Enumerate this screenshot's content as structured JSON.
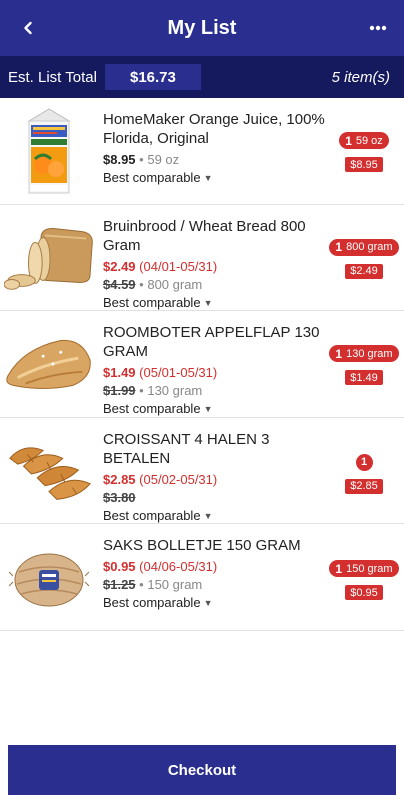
{
  "header": {
    "title": "My List",
    "back_icon": "chevron-left-icon",
    "more_icon": "more-horizontal-icon"
  },
  "totalbar": {
    "label": "Est. List Total",
    "amount": "$16.73",
    "count": "5 item(s)"
  },
  "items": [
    {
      "name": "HomeMaker Orange Juice, 100% Florida, Original",
      "price": "$8.95",
      "size": "59 oz",
      "compare": "Best comparable",
      "qty": "1",
      "qty_unit": "59 oz",
      "tag": "$8.95",
      "image": "orange-juice-carton-image"
    },
    {
      "name": "Bruinbrood / Wheat Bread 800 Gram",
      "price": "$2.49",
      "dates": "(04/01-05/31)",
      "old_price": "$4.59",
      "size": "800 gram",
      "compare": "Best comparable",
      "qty": "1",
      "qty_unit": "800 gram",
      "tag": "$2.49",
      "image": "wheat-bread-loaf-image"
    },
    {
      "name": "ROOMBOTER APPELFLAP 130 GRAM",
      "price": "$1.49",
      "dates": "(05/01-05/31)",
      "old_price": "$1.99",
      "size": "130 gram",
      "compare": "Best comparable",
      "qty": "1",
      "qty_unit": "130 gram",
      "tag": "$1.49",
      "image": "apple-turnover-pastry-image"
    },
    {
      "name": "CROISSANT 4 HALEN 3 BETALEN",
      "price": "$2.85",
      "dates": "(05/02-05/31)",
      "old_price": "$3.80",
      "compare": "Best comparable",
      "qty": "1",
      "tag": "$2.85",
      "image": "croissants-image"
    },
    {
      "name": "SAKS BOLLETJE 150 GRAM",
      "price": "$0.95",
      "dates": "(04/06-05/31)",
      "old_price": "$1.25",
      "size": "150 gram",
      "compare": "Best comparable",
      "qty": "1",
      "qty_unit": "150 gram",
      "tag": "$0.95",
      "image": "packaged-bread-roll-image"
    }
  ],
  "checkout": {
    "label": "Checkout"
  },
  "colors": {
    "header": "#2a2f8f",
    "totalbar": "#15195e",
    "sale_red": "#d32f2f"
  }
}
